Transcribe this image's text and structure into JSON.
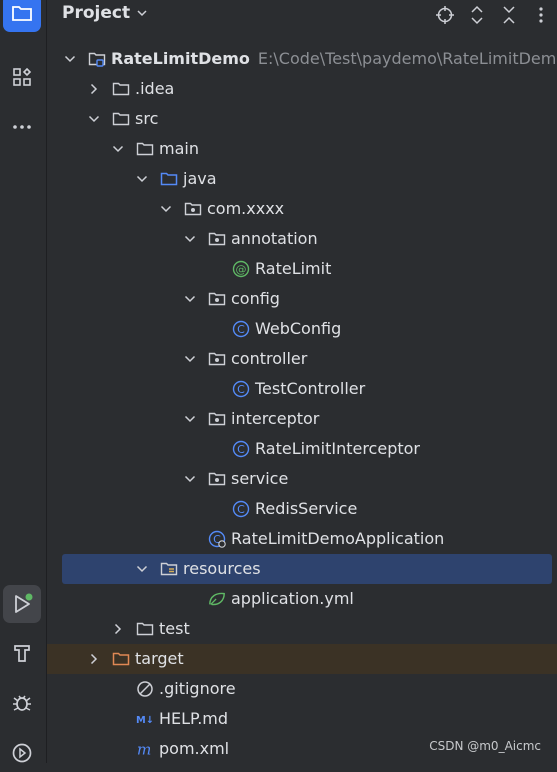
{
  "header": {
    "title": "Project"
  },
  "tree": [
    {
      "label": "RateLimitDemo",
      "path": "E:\\Code\\Test\\paydemo\\RateLimitDemo",
      "icon": "module-icon",
      "arrow": "down",
      "depth": 0
    },
    {
      "label": ".idea",
      "icon": "folder-icon",
      "arrow": "right",
      "depth": 1
    },
    {
      "label": "src",
      "icon": "folder-icon",
      "arrow": "down",
      "depth": 1
    },
    {
      "label": "main",
      "icon": "folder-icon",
      "arrow": "down",
      "depth": 2
    },
    {
      "label": "java",
      "icon": "source-folder-icon",
      "arrow": "down",
      "depth": 3
    },
    {
      "label": "com.xxxx",
      "icon": "package-icon",
      "arrow": "down",
      "depth": 4
    },
    {
      "label": "annotation",
      "icon": "package-icon",
      "arrow": "down",
      "depth": 5
    },
    {
      "label": "RateLimit",
      "icon": "annotation-icon",
      "arrow": "",
      "depth": 6
    },
    {
      "label": "config",
      "icon": "package-icon",
      "arrow": "down",
      "depth": 5
    },
    {
      "label": "WebConfig",
      "icon": "class-icon",
      "arrow": "",
      "depth": 6
    },
    {
      "label": "controller",
      "icon": "package-icon",
      "arrow": "down",
      "depth": 5
    },
    {
      "label": "TestController",
      "icon": "class-icon",
      "arrow": "",
      "depth": 6
    },
    {
      "label": "interceptor",
      "icon": "package-icon",
      "arrow": "down",
      "depth": 5
    },
    {
      "label": "RateLimitInterceptor",
      "icon": "class-icon",
      "arrow": "",
      "depth": 6
    },
    {
      "label": "service",
      "icon": "package-icon",
      "arrow": "down",
      "depth": 5
    },
    {
      "label": "RedisService",
      "icon": "class-icon",
      "arrow": "",
      "depth": 6
    },
    {
      "label": "RateLimitDemoApplication",
      "icon": "spring-class-icon",
      "arrow": "",
      "depth": 5
    },
    {
      "label": "resources",
      "icon": "resources-folder-icon",
      "arrow": "down",
      "depth": 3,
      "selected": true
    },
    {
      "label": "application.yml",
      "icon": "yaml-spring-icon",
      "arrow": "",
      "depth": 5
    },
    {
      "label": "test",
      "icon": "folder-icon",
      "arrow": "right",
      "depth": 2
    },
    {
      "label": "target",
      "icon": "excluded-folder-icon",
      "arrow": "right",
      "depth": 1,
      "excluded": true
    },
    {
      "label": ".gitignore",
      "icon": "ignore-file-icon",
      "arrow": "",
      "depth": 2
    },
    {
      "label": "HELP.md",
      "icon": "markdown-icon",
      "arrow": "",
      "depth": 2
    },
    {
      "label": "pom.xml",
      "icon": "maven-icon",
      "arrow": "",
      "depth": 2
    }
  ],
  "watermark": "CSDN @m0_Aicmc",
  "colors": {
    "accent": "#3574f0",
    "selection": "#2e436e",
    "excluded": "#3b3225"
  }
}
